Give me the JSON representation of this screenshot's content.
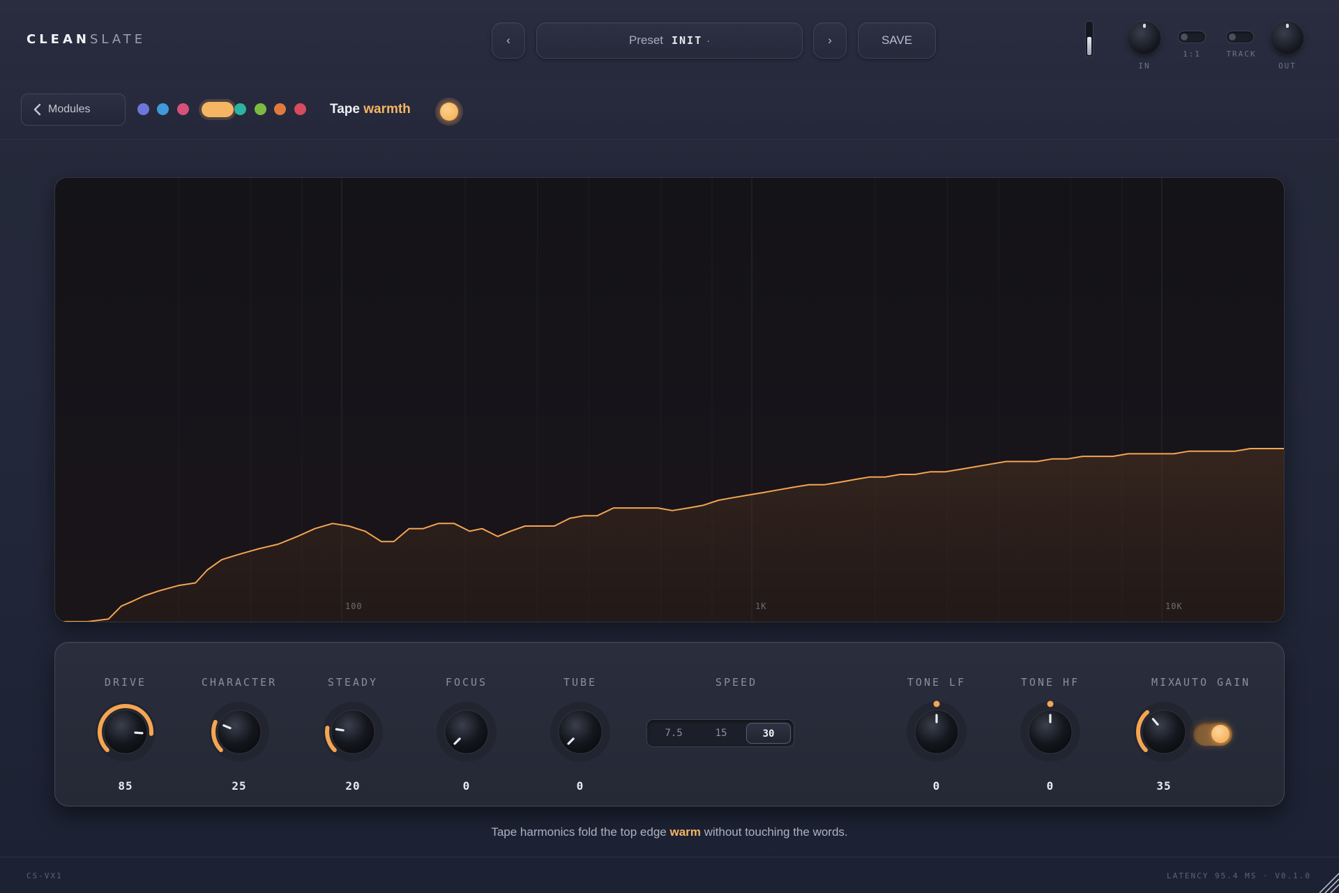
{
  "app": {
    "logo_bold": "CLEAN",
    "logo_light": "SLATE"
  },
  "header": {
    "prev_icon": "‹",
    "next_icon": "›",
    "preset_label": "Preset",
    "preset_name": "INIT",
    "preset_dirty": "·",
    "save_label": "SAVE",
    "in_label": "IN",
    "ratio_label": "1:1",
    "track_label": "TRACK",
    "out_label": "OUT",
    "meter_level": 0.55
  },
  "subbar": {
    "modules_label": "Modules",
    "module_name_1": "Tape",
    "module_name_2": "warmth",
    "swatches": [
      "#6f76d9",
      "#3e9ad8",
      "#d6517a",
      "#f5b563",
      "#2cb3a2",
      "#7cbb42",
      "#e07a3e",
      "#d84a5e"
    ],
    "active_swatch": 3
  },
  "graph": {
    "freq_labels": [
      "100",
      "1K",
      "10K"
    ],
    "accent": "#f5a552"
  },
  "chart_data": {
    "type": "area",
    "x_scale": "log",
    "x_ticks": [
      "100",
      "1K",
      "10K"
    ],
    "y_scale": "unlabeled",
    "note": "spectrum curve",
    "points": [
      [
        20,
        0.0
      ],
      [
        24,
        0.0
      ],
      [
        27,
        0.01
      ],
      [
        29,
        0.06
      ],
      [
        31,
        0.08
      ],
      [
        33,
        0.1
      ],
      [
        36,
        0.12
      ],
      [
        40,
        0.14
      ],
      [
        44,
        0.15
      ],
      [
        47,
        0.2
      ],
      [
        51,
        0.24
      ],
      [
        56,
        0.26
      ],
      [
        62,
        0.28
      ],
      [
        70,
        0.3
      ],
      [
        78,
        0.33
      ],
      [
        86,
        0.36
      ],
      [
        95,
        0.38
      ],
      [
        104,
        0.37
      ],
      [
        114,
        0.35
      ],
      [
        125,
        0.31
      ],
      [
        134,
        0.31
      ],
      [
        146,
        0.36
      ],
      [
        158,
        0.36
      ],
      [
        172,
        0.38
      ],
      [
        188,
        0.38
      ],
      [
        205,
        0.35
      ],
      [
        220,
        0.36
      ],
      [
        240,
        0.33
      ],
      [
        258,
        0.35
      ],
      [
        280,
        0.37
      ],
      [
        305,
        0.37
      ],
      [
        330,
        0.37
      ],
      [
        360,
        0.4
      ],
      [
        390,
        0.41
      ],
      [
        420,
        0.41
      ],
      [
        460,
        0.44
      ],
      [
        500,
        0.44
      ],
      [
        545,
        0.44
      ],
      [
        590,
        0.44
      ],
      [
        640,
        0.43
      ],
      [
        700,
        0.44
      ],
      [
        760,
        0.45
      ],
      [
        830,
        0.47
      ],
      [
        900,
        0.48
      ],
      [
        980,
        0.49
      ],
      [
        1070,
        0.5
      ],
      [
        1160,
        0.51
      ],
      [
        1260,
        0.52
      ],
      [
        1380,
        0.53
      ],
      [
        1500,
        0.53
      ],
      [
        1640,
        0.54
      ],
      [
        1780,
        0.55
      ],
      [
        1940,
        0.56
      ],
      [
        2120,
        0.56
      ],
      [
        2300,
        0.57
      ],
      [
        2500,
        0.57
      ],
      [
        2720,
        0.58
      ],
      [
        2960,
        0.58
      ],
      [
        3230,
        0.59
      ],
      [
        3520,
        0.6
      ],
      [
        3830,
        0.61
      ],
      [
        4170,
        0.62
      ],
      [
        4550,
        0.62
      ],
      [
        4960,
        0.62
      ],
      [
        5400,
        0.63
      ],
      [
        5880,
        0.63
      ],
      [
        6410,
        0.64
      ],
      [
        6980,
        0.64
      ],
      [
        7600,
        0.64
      ],
      [
        8280,
        0.65
      ],
      [
        9020,
        0.65
      ],
      [
        9830,
        0.65
      ],
      [
        10700,
        0.65
      ],
      [
        11660,
        0.66
      ],
      [
        12700,
        0.66
      ],
      [
        13830,
        0.66
      ],
      [
        15070,
        0.66
      ],
      [
        16410,
        0.67
      ],
      [
        17880,
        0.67
      ],
      [
        19480,
        0.67
      ],
      [
        20000,
        0.67
      ]
    ]
  },
  "controls": [
    {
      "id": "drive",
      "label": "DRIVE",
      "value": "85",
      "pct": 0.85,
      "arc": true
    },
    {
      "id": "character",
      "label": "CHARACTER",
      "value": "25",
      "pct": 0.25,
      "arc": true
    },
    {
      "id": "steady",
      "label": "STEADY",
      "value": "20",
      "pct": 0.2,
      "arc": true
    },
    {
      "id": "focus",
      "label": "FOCUS",
      "value": "0",
      "pct": 0.0,
      "arc": false
    },
    {
      "id": "tube",
      "label": "TUBE",
      "value": "0",
      "pct": 0.0,
      "arc": false
    },
    {
      "id": "tone-lf",
      "label": "TONE LF",
      "value": "0",
      "pct": 0.5,
      "arc": false,
      "center": true
    },
    {
      "id": "tone-hf",
      "label": "TONE HF",
      "value": "0",
      "pct": 0.5,
      "arc": false,
      "center": true
    },
    {
      "id": "mix",
      "label": "MIX",
      "value": "35",
      "pct": 0.35,
      "arc": true
    }
  ],
  "speed": {
    "label": "SPEED",
    "options": [
      "7.5",
      "15",
      "30"
    ],
    "selected": 2
  },
  "auto_gain": {
    "label": "AUTO GAIN",
    "on": true
  },
  "caption": {
    "pre": "Tape harmonics fold the top edge",
    "accent": "warm",
    "post": "without touching the words."
  },
  "footer": {
    "left": "CS-VX1",
    "right": "LATENCY 95.4 MS · V0.1.0"
  }
}
